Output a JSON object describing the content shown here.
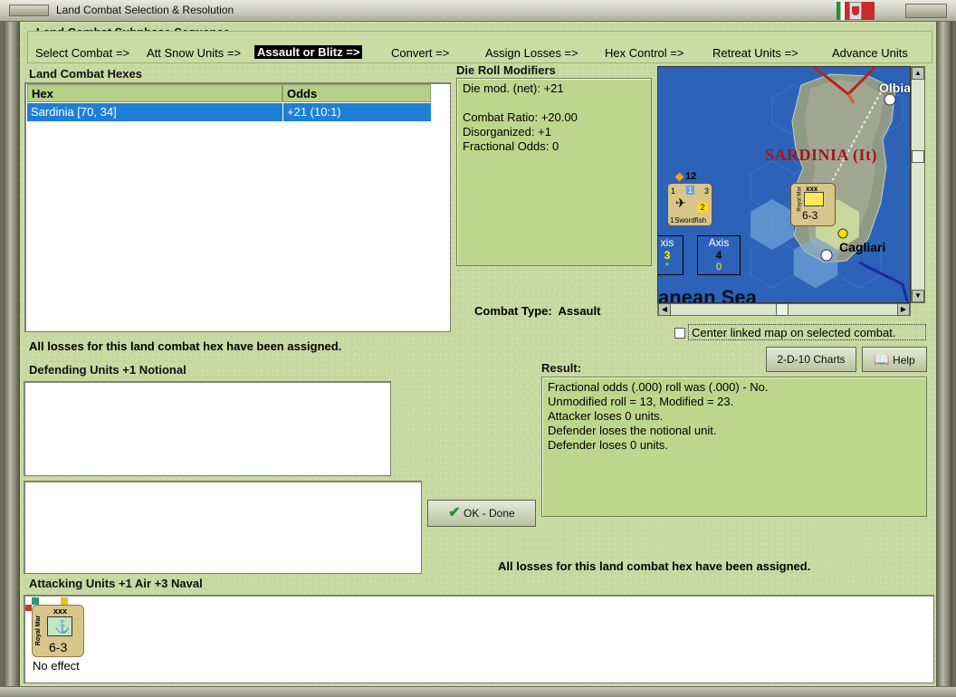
{
  "window": {
    "title": "Land Combat Selection & Resolution"
  },
  "sequence": {
    "title": "Land Combat Subphase Sequence",
    "steps": [
      "Select Combat =>",
      "Att Snow Units =>",
      "Assault or Blitz =>",
      "Convert =>",
      "Assign Losses =>",
      "Hex Control =>",
      "Retreat Units =>",
      "Advance Units"
    ],
    "active_index": 2
  },
  "hexes": {
    "title": "Land Combat Hexes",
    "columns": [
      "Hex",
      "Odds"
    ],
    "rows": [
      {
        "hex": "Sardinia [70, 34]",
        "odds": "+21 (10:1)"
      }
    ]
  },
  "modifiers": {
    "title": "Die Roll Modifiers",
    "lines": [
      "Die mod. (net): +21",
      "",
      "Combat Ratio: +20.00",
      "Disorganized: +1",
      "Fractional Odds: 0"
    ]
  },
  "combat_type": {
    "label": "Combat Type:",
    "value": "Assault"
  },
  "map": {
    "region_label": "SARDINIA (It)",
    "city_1": "Olbia",
    "city_2": "Cagliari",
    "sea_label": "anean Sea",
    "axis_box_1": {
      "label": "xis",
      "value": "3",
      "sub": "*"
    },
    "axis_box_2": {
      "label": "Axis",
      "value": "4",
      "sub": "0"
    },
    "air_unit": {
      "name": "Swordfish",
      "count": "1",
      "stack": "12",
      "left": "1",
      "mid": "1",
      "right": "3",
      "circle": "2"
    },
    "land_unit": {
      "size": "xxx",
      "side_text": "Royal Mar",
      "strength": "6-3"
    }
  },
  "center_map": {
    "label": "Center linked map on selected combat."
  },
  "status_top": "All losses for this land combat hex have been assigned.",
  "status_bottom": "All losses for this land combat hex have been assigned.",
  "buttons": {
    "charts": "2-D-10 Charts",
    "help": "Help",
    "ok": "OK - Done"
  },
  "defending": {
    "title": "Defending Units +1 Notional"
  },
  "result": {
    "title": "Result:",
    "lines": [
      "Fractional odds (.000) roll was (.000)  - No.",
      "Unmodified roll = 13, Modified = 23.",
      "Attacker loses 0 units.",
      "Defender loses the notional unit.",
      "Defender loses 0 units."
    ]
  },
  "attacking": {
    "title": "Attacking Units +1 Air +3 Naval",
    "unit": {
      "size": "xxx",
      "side_text": "Royal Mar",
      "strength": "6-3",
      "caption": "No effect"
    }
  },
  "colors": {
    "panel_bg": "#c7d9a0",
    "selection": "#1e7fd6",
    "sea": "#2c63b8",
    "region_red": "#a01818"
  }
}
